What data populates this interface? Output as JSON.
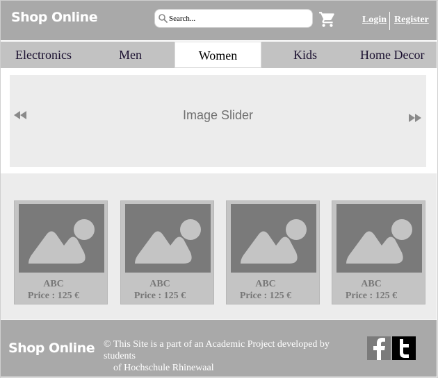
{
  "header": {
    "logo": "Shop Online",
    "search_placeholder": "Search...",
    "login": "Login",
    "register": "Register"
  },
  "nav": {
    "items": [
      "Electronics",
      "Men",
      "Women",
      "Kids",
      "Home Decor"
    ],
    "active": "Women"
  },
  "slider": {
    "label": "Image Slider"
  },
  "products": [
    {
      "name": "ABC",
      "price": "Price : 125 €"
    },
    {
      "name": "ABC",
      "price": "Price : 125 €"
    },
    {
      "name": "ABC",
      "price": "Price : 125 €"
    },
    {
      "name": "ABC",
      "price": "Price : 125 €"
    }
  ],
  "footer": {
    "logo": "Shop Online",
    "copyright_line1": "© This Site is a part of an Academic Project developed by students",
    "copyright_line2": "of Hochschule Rhinewaal"
  },
  "icons": {
    "search": "search-icon",
    "cart": "cart-icon",
    "prev": "rewind-icon",
    "next": "fast-forward-icon",
    "facebook": "facebook-icon",
    "twitter": "twitter-icon"
  },
  "colors": {
    "header_bg": "#a9a9a9",
    "nav_bg": "#c2c2c2",
    "slider_bg": "#ececec",
    "card_bg": "#c4c4c4",
    "image_placeholder": "#7a7a7a"
  }
}
